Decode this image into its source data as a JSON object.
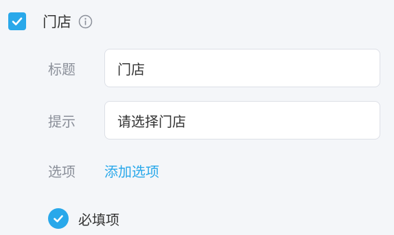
{
  "header": {
    "checked": true,
    "title": "门店",
    "info_icon": "info-circle-icon"
  },
  "fields": [
    {
      "label": "标题",
      "value": "门店"
    },
    {
      "label": "提示",
      "value": "请选择门店"
    }
  ],
  "options": {
    "label": "选项",
    "add_link": "添加选项"
  },
  "required": {
    "checked": true,
    "label": "必填项"
  },
  "colors": {
    "accent": "#29a8ea",
    "background": "#f4f6f9",
    "label_gray": "#8a8f99",
    "text": "#333333"
  }
}
